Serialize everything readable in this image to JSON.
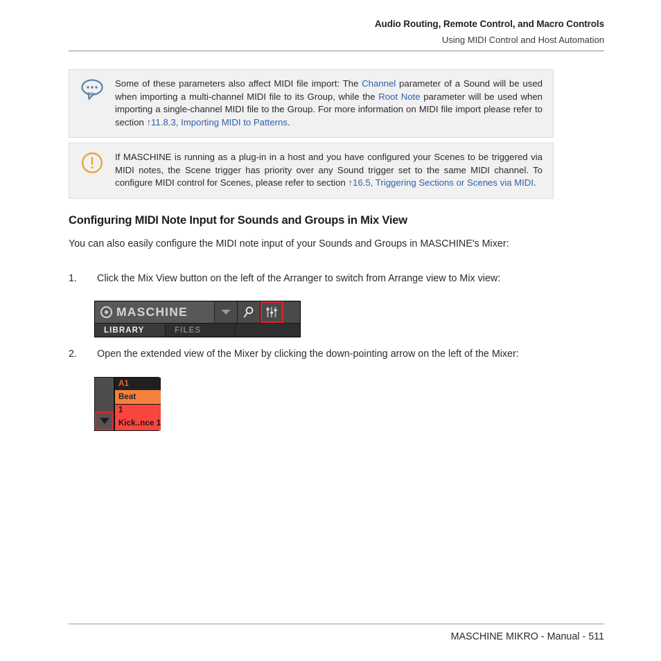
{
  "header": {
    "title": "Audio Routing, Remote Control, and Macro Controls",
    "subtitle": "Using MIDI Control and Host Automation"
  },
  "callouts": [
    {
      "icon": "speech-bubble-icon",
      "icon_color": "#5b83a8",
      "segments": [
        {
          "text": "Some of these parameters also affect MIDI file import: The ",
          "style": "plain"
        },
        {
          "text": "Channel",
          "style": "link"
        },
        {
          "text": " parameter of a Sound will be used when importing a multi-channel MIDI file to its Group, while the ",
          "style": "plain"
        },
        {
          "text": "Root Note",
          "style": "link"
        },
        {
          "text": " parameter will be used when importing a single-channel MIDI file to the Group. For more information on MIDI file import please refer to section ",
          "style": "plain"
        },
        {
          "text": "↑11.8.3, Importing MIDI to Patterns",
          "style": "link"
        },
        {
          "text": ".",
          "style": "plain"
        }
      ]
    },
    {
      "icon": "warning-circle-icon",
      "icon_color": "#e8a33d",
      "segments": [
        {
          "text": "If MASCHINE is running as a plug-in in a host and you have configured your Scenes to be triggered via MIDI notes, the Scene trigger has priority over any Sound trigger set to the same MIDI channel. To configure MIDI control for Scenes, please refer to section ",
          "style": "plain"
        },
        {
          "text": "↑16.5, Triggering Sections or Scenes via MIDI",
          "style": "link"
        },
        {
          "text": ".",
          "style": "plain"
        }
      ]
    }
  ],
  "section": {
    "heading": "Configuring MIDI Note Input for Sounds and Groups in Mix View",
    "intro": "You can also easily configure the MIDI note input of your Sounds and Groups in MASCHINE's Mixer:"
  },
  "steps": [
    {
      "number": "1.",
      "text": "Click the Mix View button on the left of the Arranger to switch from Arrange view to Mix view:"
    },
    {
      "number": "2.",
      "text": "Open the extended view of the Mixer by clicking the down-pointing arrow on the left of the Mixer:"
    }
  ],
  "maschine_widget": {
    "logo_text": "MASCHINE",
    "logo_mark": "concentric-circle-icon",
    "buttons": [
      {
        "name": "chevron-down-icon",
        "label": ""
      },
      {
        "name": "search-icon",
        "label": ""
      },
      {
        "name": "mix-view-icon",
        "label": "",
        "highlighted": true
      }
    ],
    "tabs": [
      {
        "label": "LIBRARY",
        "active": true
      },
      {
        "label": "FILES",
        "active": false
      }
    ],
    "highlight_color": "#e8232a"
  },
  "mixer_widget": {
    "group_label": "A1",
    "group_name": "Beat",
    "sound_number": "1",
    "sound_name": "Kick..nce 1",
    "arrow_icon": "triangle-down-icon",
    "highlight_color": "#e8232a",
    "group_color": "#f5813f",
    "sound_color": "#f9453e"
  },
  "footer": {
    "text": "MASCHINE MIKRO - Manual - 511"
  }
}
